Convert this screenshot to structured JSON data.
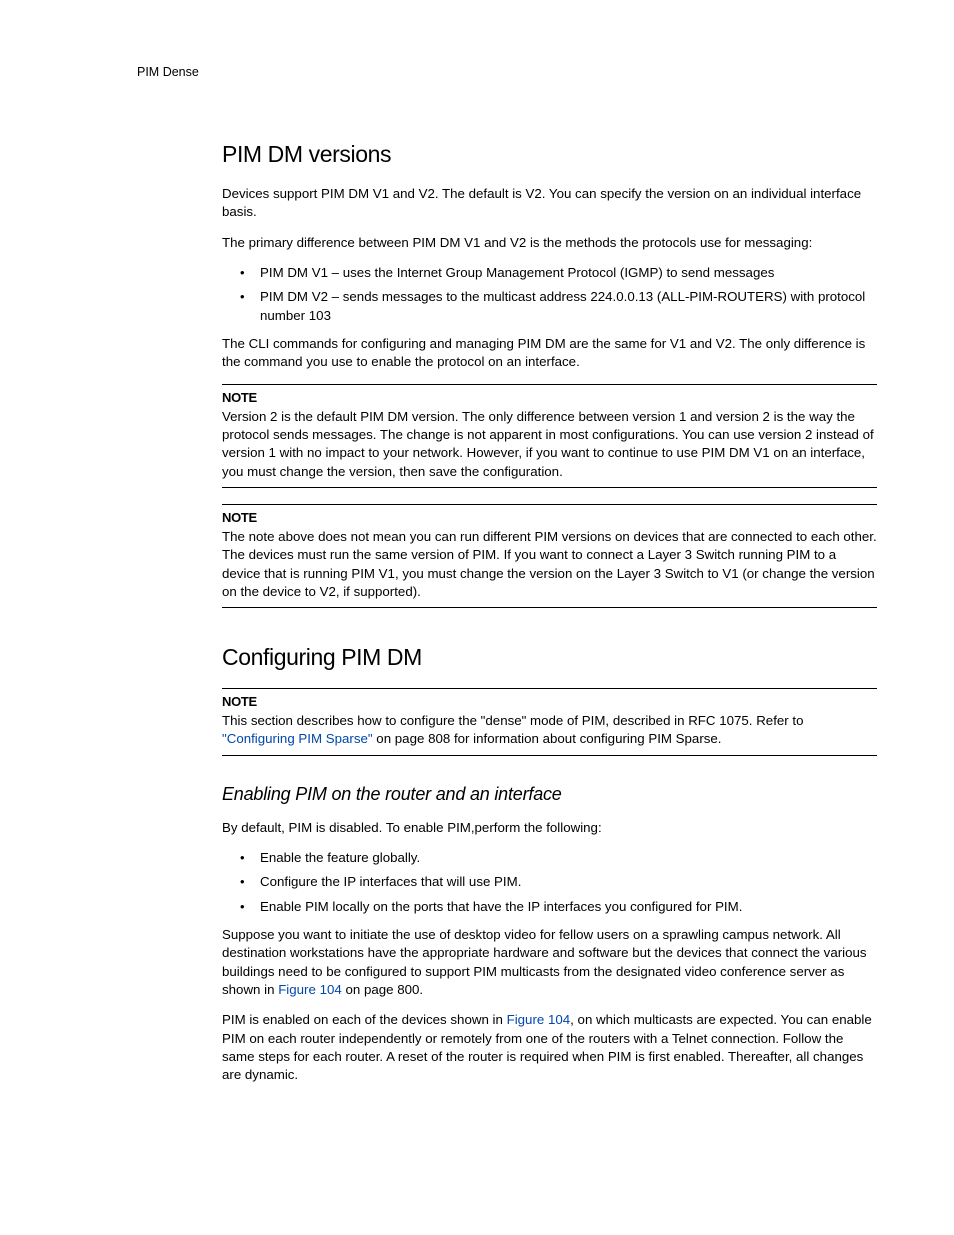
{
  "running_head": "PIM Dense",
  "s1": {
    "heading": "PIM DM versions",
    "p1": "Devices support PIM DM V1 and V2. The default is V2. You can specify the version on an individual interface basis.",
    "p2": "The primary difference between PIM DM V1 and V2 is the methods the protocols use for messaging:",
    "bullets": [
      "PIM DM V1 – uses the Internet Group Management Protocol (IGMP) to send messages",
      "PIM DM V2 – sends messages to the multicast address 224.0.0.13 (ALL-PIM-ROUTERS) with protocol number 103"
    ],
    "p3": "The CLI commands for configuring and managing PIM DM are the same for V1 and V2.  The only difference is the command you use to enable the protocol on an interface.",
    "note1": {
      "label": "NOTE",
      "body": "Version 2 is the default PIM DM version.  The only difference between version 1 and version 2 is the way the protocol sends messages.  The change is not apparent in most configurations.  You can use version 2 instead of version 1 with no impact to your network.  However, if you want to continue to use PIM DM V1 on an interface, you must change the version, then save the configuration."
    },
    "note2": {
      "label": "NOTE",
      "body": "The note above does not mean you can run different PIM versions on devices that are connected to each other. The devices must run the same version of PIM. If you want to connect a Layer 3 Switch running PIM to a device that is running PIM V1, you must change the version on the Layer 3 Switch to V1 (or change the version on the device to V2, if supported)."
    }
  },
  "s2": {
    "heading": "Configuring PIM DM",
    "note3": {
      "label": "NOTE",
      "body_pre": "This section describes how to configure the \"dense\" mode of PIM, described in RFC 1075. Refer to ",
      "link_text": "\"Configuring PIM Sparse\"",
      "body_post": " on page 808 for information about configuring PIM Sparse."
    },
    "sub": {
      "heading": "Enabling PIM on the router and an interface",
      "p1": "By default, PIM is disabled.  To enable PIM,perform the following:",
      "bullets": [
        "Enable the feature globally.",
        "Configure the IP interfaces that will use PIM.",
        "Enable PIM locally on the ports that have the IP interfaces you configured for PIM."
      ],
      "p2_pre": "Suppose you want to initiate the use of desktop video for fellow users on a sprawling campus network. All destination workstations have the appropriate hardware and software but the devices that connect the various buildings need to be configured to support PIM multicasts from the designated video conference server as shown in ",
      "p2_link": "Figure 104",
      "p2_post": " on page 800.",
      "p3_pre": "PIM is enabled on each of the devices shown in ",
      "p3_link": "Figure 104",
      "p3_post": ", on which multicasts are expected. You can enable PIM on each router independently or remotely from one of the routers with a Telnet connection. Follow the same steps for each router. A reset of the router is required when PIM is first enabled. Thereafter, all changes are dynamic."
    }
  }
}
